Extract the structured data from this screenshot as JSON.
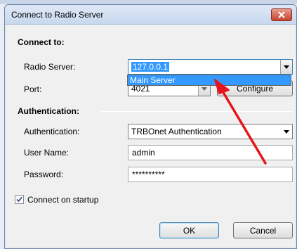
{
  "dialog": {
    "title": "Connect to Radio Server"
  },
  "connect_section": {
    "header": "Connect to:",
    "radio_server_label": "Radio Server:",
    "radio_server_value": "127.0.0.1",
    "port_label": "Port:",
    "port_value": "4021",
    "configure_label": "Configure"
  },
  "dropdown": {
    "items": [
      "Main Server"
    ]
  },
  "auth_section": {
    "header": "Authentication:",
    "auth_label": "Authentication:",
    "auth_value": "TRBOnet Authentication",
    "username_label": "User Name:",
    "username_value": "admin",
    "password_label": "Password:",
    "password_value": "**********"
  },
  "options": {
    "connect_on_startup_label": "Connect on startup",
    "connect_on_startup_checked": true
  },
  "buttons": {
    "ok_label": "OK",
    "cancel_label": "Cancel"
  },
  "colors": {
    "annotation_arrow": "#e8141b",
    "selection": "#3399ff"
  }
}
